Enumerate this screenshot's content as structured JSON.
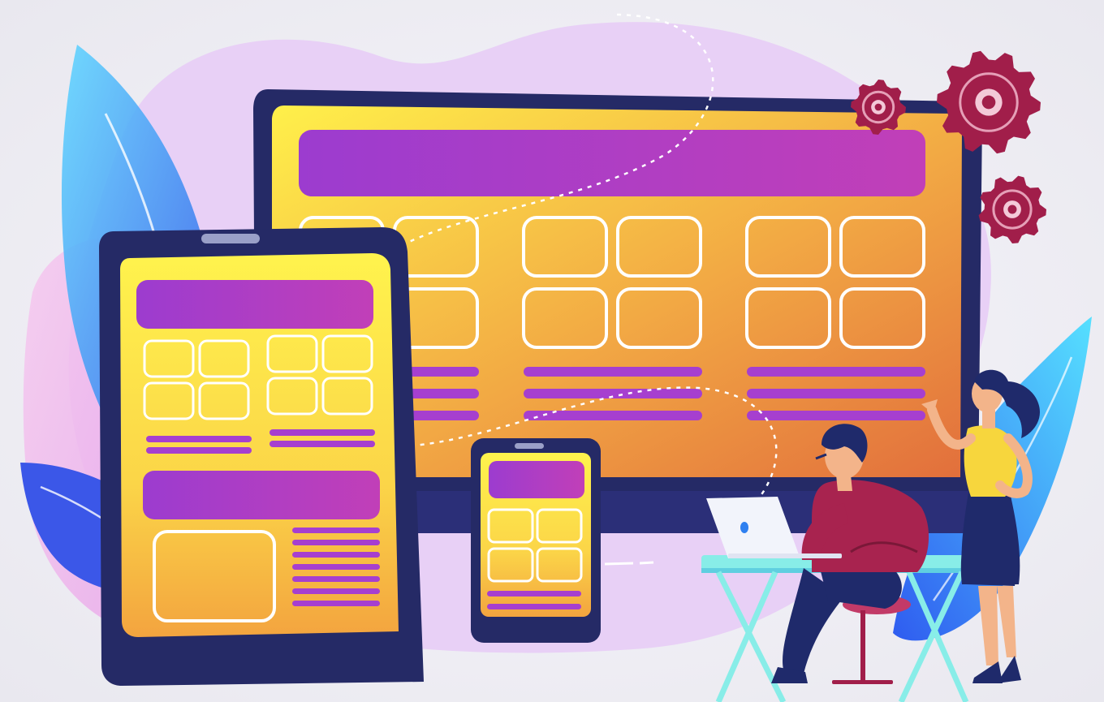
{
  "palette": {
    "background": "#f0eff5",
    "lavender": "#e6cdf6",
    "purple": "#a63fcf",
    "navy": "#252a66",
    "screen_top": "#fff04a",
    "screen_bottom": "#e27a3c",
    "gear": "#a11e4a",
    "leaf_blue": "#2f80f0",
    "leaf_cyan": "#56d6ff",
    "desk": "#88ede8",
    "man_shirt": "#a8234f",
    "woman_top": "#f7d63d"
  },
  "icons": {
    "monitor": "desktop-monitor-icon",
    "tablet": "tablet-icon",
    "phone": "smartphone-icon",
    "gear": "gear-icon",
    "laptop": "laptop-icon"
  },
  "monitor": {
    "grid_groups": 3,
    "cards_per_group": 4
  },
  "tablet": {
    "grid_groups": 2,
    "cards_per_group": 4
  },
  "phone": {
    "cards": 4
  },
  "gears": {
    "count": 3
  }
}
